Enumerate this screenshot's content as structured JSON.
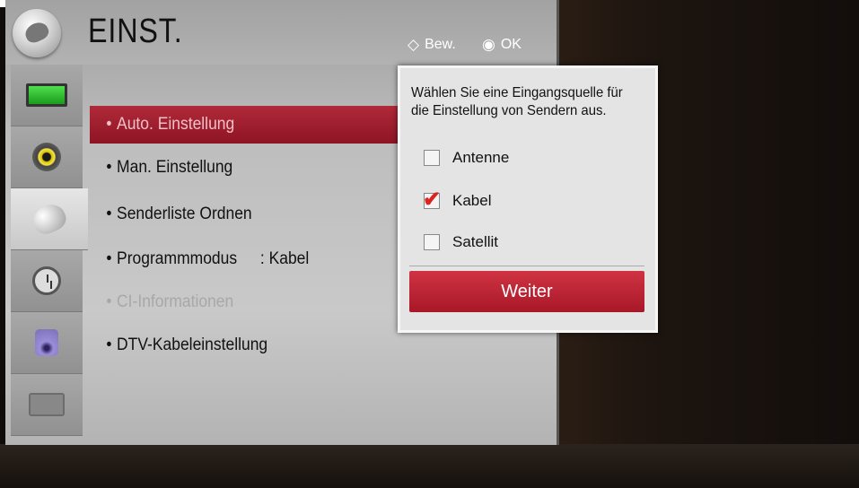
{
  "header": {
    "title": "EINST.",
    "hint_move_glyph": "◇",
    "hint_move_label": "Bew.",
    "hint_ok_glyph": "◉",
    "hint_ok_label": "OK"
  },
  "sidebar": {
    "items": [
      {
        "icon": "picture-icon"
      },
      {
        "icon": "audio-icon"
      },
      {
        "icon": "satellite-dish-icon",
        "active": true
      },
      {
        "icon": "clock-icon"
      },
      {
        "icon": "lock-icon"
      },
      {
        "icon": "suitcase-icon"
      }
    ]
  },
  "menu": {
    "items": [
      {
        "label": "Auto. Einstellung",
        "selected": true
      },
      {
        "label": "Man. Einstellung"
      },
      {
        "label": "Senderliste Ordnen"
      },
      {
        "label": "Programmmodus",
        "value": ": Kabel"
      },
      {
        "label": "CI-Informationen",
        "disabled": true
      },
      {
        "label": "DTV-Kabeleinstellung"
      }
    ],
    "bullet": "•"
  },
  "popup": {
    "message": "Wählen Sie eine Eingangsquelle für die Einstellung von Sendern aus.",
    "options": [
      {
        "label": "Antenne",
        "checked": false
      },
      {
        "label": "Kabel",
        "checked": true
      },
      {
        "label": "Satellit",
        "checked": false
      }
    ],
    "check_glyph": "✔",
    "button_label": "Weiter"
  },
  "colors": {
    "accent": "#b02a3a",
    "check": "#dd2222"
  }
}
